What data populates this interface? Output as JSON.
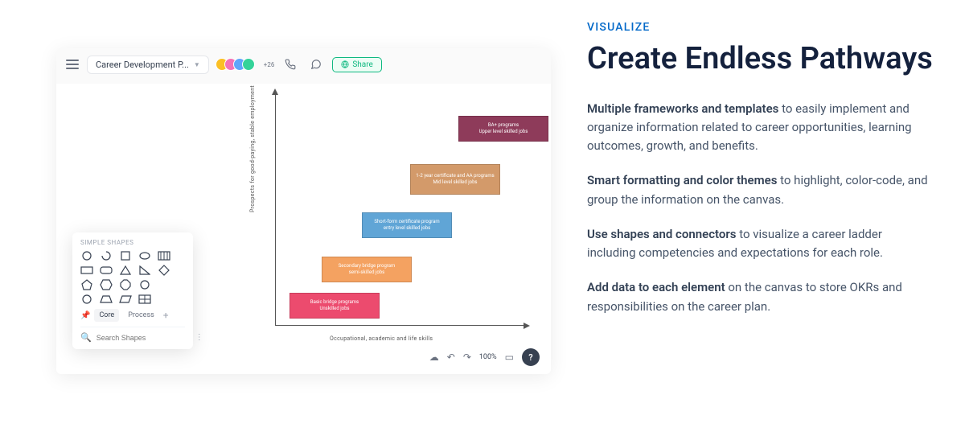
{
  "app": {
    "doc_title": "Career Development P...",
    "avatar_more": "+26",
    "share_label": "Share",
    "zoom": "100%"
  },
  "axes": {
    "y": "Prospects   for   good-paying,    stable   employment",
    "x": "Occupational,     academic    and   life  skills"
  },
  "steps": {
    "s1a": "Basic  bridge   programs",
    "s1b": "Unskilled   jobs",
    "s2a": "Secondary   bridge   program",
    "s2b": "semi-skilled    jobs",
    "s3a": "Short-form    certificate   program",
    "s3b": "entry   level  skilled   jobs",
    "s4a": "1-2   year   certificate    and  AA programs",
    "s4b": "Mid   level   skilled   jobs",
    "s5a": "BA+  programs",
    "s5b": "Upper   level   skilled   jobs"
  },
  "shapes": {
    "title": "SIMPLE SHAPES",
    "tab_core": "Core",
    "tab_process": "Process",
    "search_placeholder": "Search Shapes"
  },
  "marketing": {
    "eyebrow": "VISUALIZE",
    "headline": "Create Endless Pathways",
    "p1_strong": "Multiple frameworks and templates",
    "p1_rest": " to easily implement and organize information related to career opportunities, learning outcomes, growth, and benefits.",
    "p2_strong": "Smart formatting and color themes",
    "p2_rest": " to highlight, color-code, and group the information on the canvas.",
    "p3_strong": "Use shapes and connectors",
    "p3_rest": " to visualize a career ladder including competencies and expectations for each role.",
    "p4_strong": "Add data to each element",
    "p4_rest": " on the canvas to store OKRs and responsibilities on the career plan."
  }
}
